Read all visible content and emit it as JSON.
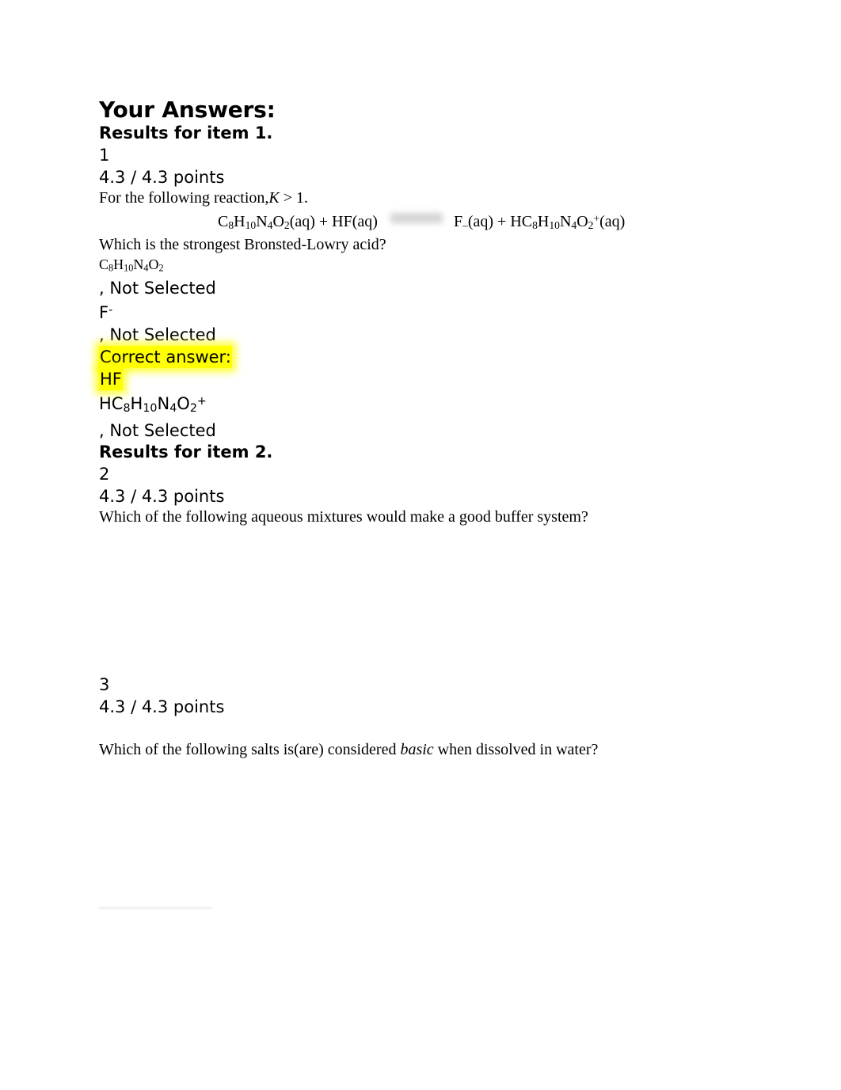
{
  "document": {
    "title": "Your Answers:"
  },
  "items": [
    {
      "heading": "Results for item 1.",
      "number": "1",
      "points": "4.3 / 4.3 points",
      "prompt_lead": "For the following reaction,",
      "prompt_symbol": "K",
      "prompt_tail": "> 1.",
      "equation": {
        "left": "C8H10N4O2(aq) + HF(aq)",
        "arrow": "blurred-equilibrium-arrow-image",
        "right": "F–(aq) + HC8H10N4O2+(aq)"
      },
      "question": "Which is the strongest Bronsted-Lowry acid?",
      "options": [
        {
          "formula": "C8H10N4O2",
          "status": ", Not Selected"
        },
        {
          "formula": "F-",
          "status": ", Not Selected"
        },
        {
          "formula": "HC8H10N4O2+",
          "status": ", Not Selected"
        }
      ],
      "correct_answer_label": "Correct answer:",
      "correct_answer_value": "HF"
    },
    {
      "heading": "Results for item 2.",
      "number": "2",
      "points": "4.3 / 4.3 points",
      "question": "Which of the following aqueous mixtures would make a good buffer system?"
    },
    {
      "number": "3",
      "points": "4.3 / 4.3 points",
      "question_lead": "Which of the following salts is(are) considered",
      "question_emphasis": "basic",
      "question_tail": "when dissolved in water?"
    }
  ],
  "colors": {
    "highlight": "#ffff00",
    "text": "#000000",
    "page_background": "#ffffff",
    "faint_rule": "#e9e9ea"
  }
}
